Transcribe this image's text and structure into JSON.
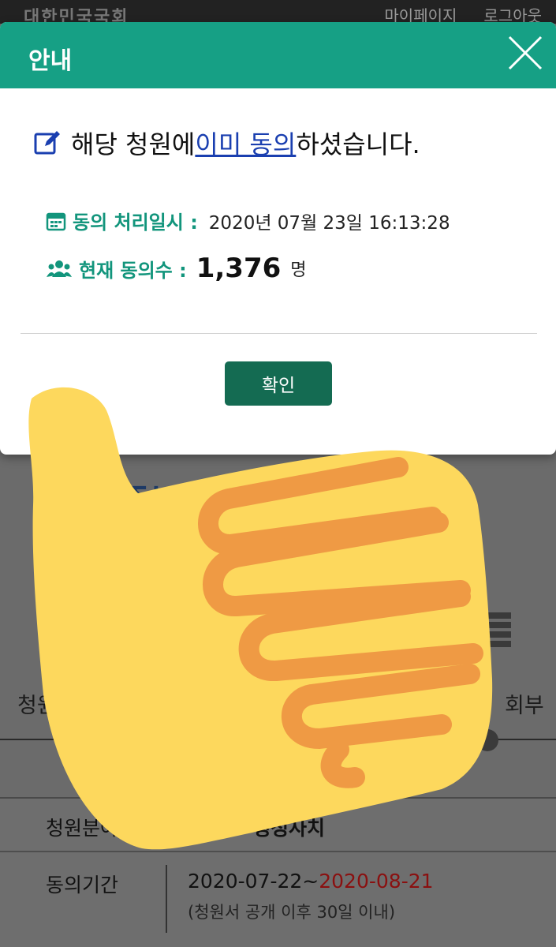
{
  "header": {
    "logo_text": "대한민국국회",
    "links": [
      "마이페이지",
      "로그아웃"
    ]
  },
  "page": {
    "title_visible": "[ 번가족부         한 강",
    "steps": {
      "first_label": "청원서 등",
      "last_label": "회부"
    },
    "info": {
      "field_label": "청원분야",
      "field_value": "행정사치",
      "period_label": "동의기간",
      "period_start": "2020-07-22~",
      "period_end": "2020-08-21",
      "period_note": "(청원서 공개 이후 30일 이내)"
    }
  },
  "modal": {
    "title": "안내",
    "message": {
      "prefix": "해당 청원에 ",
      "link": "이미 동의",
      "suffix": "하셨습니다."
    },
    "date_label": "동의 처리일시 :",
    "date_value": "2020년 07월 23일 16:13:28",
    "count_label": "현재 동의수 :",
    "count_value": "1,376",
    "count_unit": "명",
    "confirm_label": "확인"
  },
  "colors": {
    "header_bg": "#16a085",
    "label_green": "#12957c",
    "button_bg": "#146b52",
    "link_blue": "#1a3fb0",
    "date_end_red": "#8a1010",
    "thumb_fill": "#fdd85d",
    "thumb_lines": "#ef9a44"
  },
  "icons": {
    "close": "close-icon",
    "edit": "edit-icon",
    "calendar": "calendar-icon",
    "users": "users-icon",
    "sticker": "thumbs-up-emoji"
  }
}
